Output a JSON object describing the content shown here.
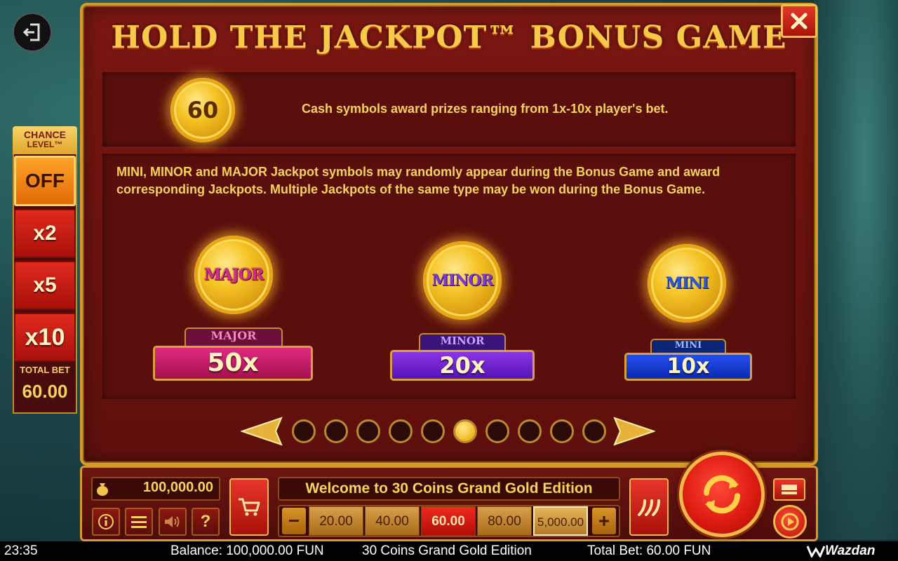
{
  "title": "HOLD THE JACKPOT™ BONUS GAME",
  "cash": {
    "coin_value": "60",
    "text": "Cash symbols award prizes ranging from 1x-10x player's bet."
  },
  "jackpot_text": "MINI, MINOR and MAJOR Jackpot symbols may randomly appear during the Bonus Game and award corresponding Jackpots. Multiple Jackpots of the same type may be won during the Bonus Game.",
  "jackpots": [
    {
      "coin_label": "MAJOR",
      "tag": "MAJOR",
      "multiplier": "50x",
      "color": "#c0145f"
    },
    {
      "coin_label": "MINOR",
      "tag": "MINOR",
      "multiplier": "20x",
      "color": "#6a1fd0"
    },
    {
      "coin_label": "MINI",
      "tag": "MINI",
      "multiplier": "10x",
      "color": "#1537d6"
    }
  ],
  "pager": {
    "total_pages": 10,
    "current_page": 6
  },
  "chance_level": {
    "label": "CHANCE",
    "label2": "LEVEL™",
    "options": [
      "OFF",
      "x2",
      "x5",
      "x10"
    ],
    "selected": "OFF"
  },
  "total_bet_panel": {
    "label": "TOTAL BET",
    "value": "60.00"
  },
  "controls": {
    "balance": "100,000.00",
    "welcome": "Welcome to 30 Coins Grand Gold Edition",
    "bet_options": [
      "20.00",
      "40.00",
      "60.00",
      "80.00",
      "5,000.00"
    ],
    "selected_bet": "60.00",
    "minus": "−",
    "plus": "+",
    "help": "?"
  },
  "statusbar": {
    "time": "23:35",
    "balance": "Balance: 100,000.00 FUN",
    "game_title": "30 Coins Grand Gold Edition",
    "total_bet": "Total Bet: 60.00 FUN",
    "brand": "Wazdan"
  }
}
